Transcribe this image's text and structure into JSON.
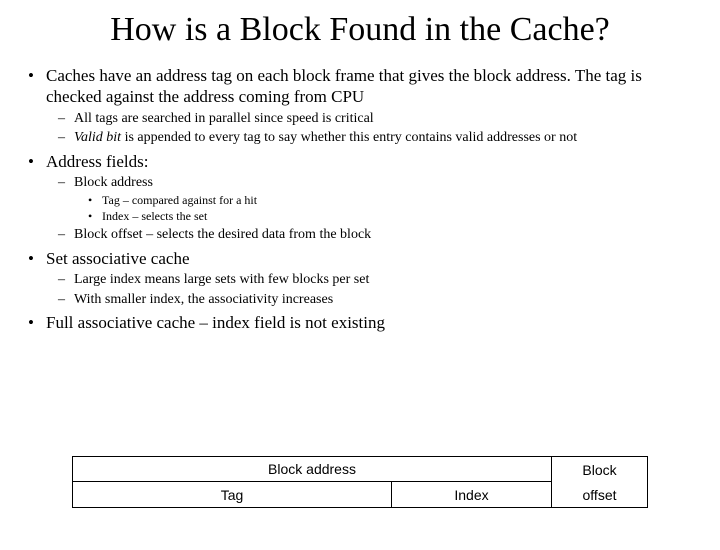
{
  "title": "How is a Block Found in the Cache?",
  "b1": {
    "text": "Caches have an address tag on each block frame that gives the block address. The tag is checked against the address coming from CPU",
    "s1": "All tags are searched in parallel since speed is critical",
    "s2_pre": "Valid bit",
    "s2_post": " is appended to every tag to say whether this entry contains valid addresses or not"
  },
  "b2": {
    "text": "Address fields:",
    "s1": "Block address",
    "s1_c1": "Tag – compared against for a hit",
    "s1_c2": "Index – selects the set",
    "s2": "Block offset – selects the desired data from the block"
  },
  "b3": {
    "text": "Set associative cache",
    "s1": "Large index means large sets with few blocks per set",
    "s2": "With smaller index, the associativity increases"
  },
  "b4": {
    "text": "Full associative cache – index field is not existing"
  },
  "diagram": {
    "block_address": "Block address",
    "block_offset_l1": "Block",
    "block_offset_l2": "offset",
    "tag": "Tag",
    "index": "Index"
  }
}
